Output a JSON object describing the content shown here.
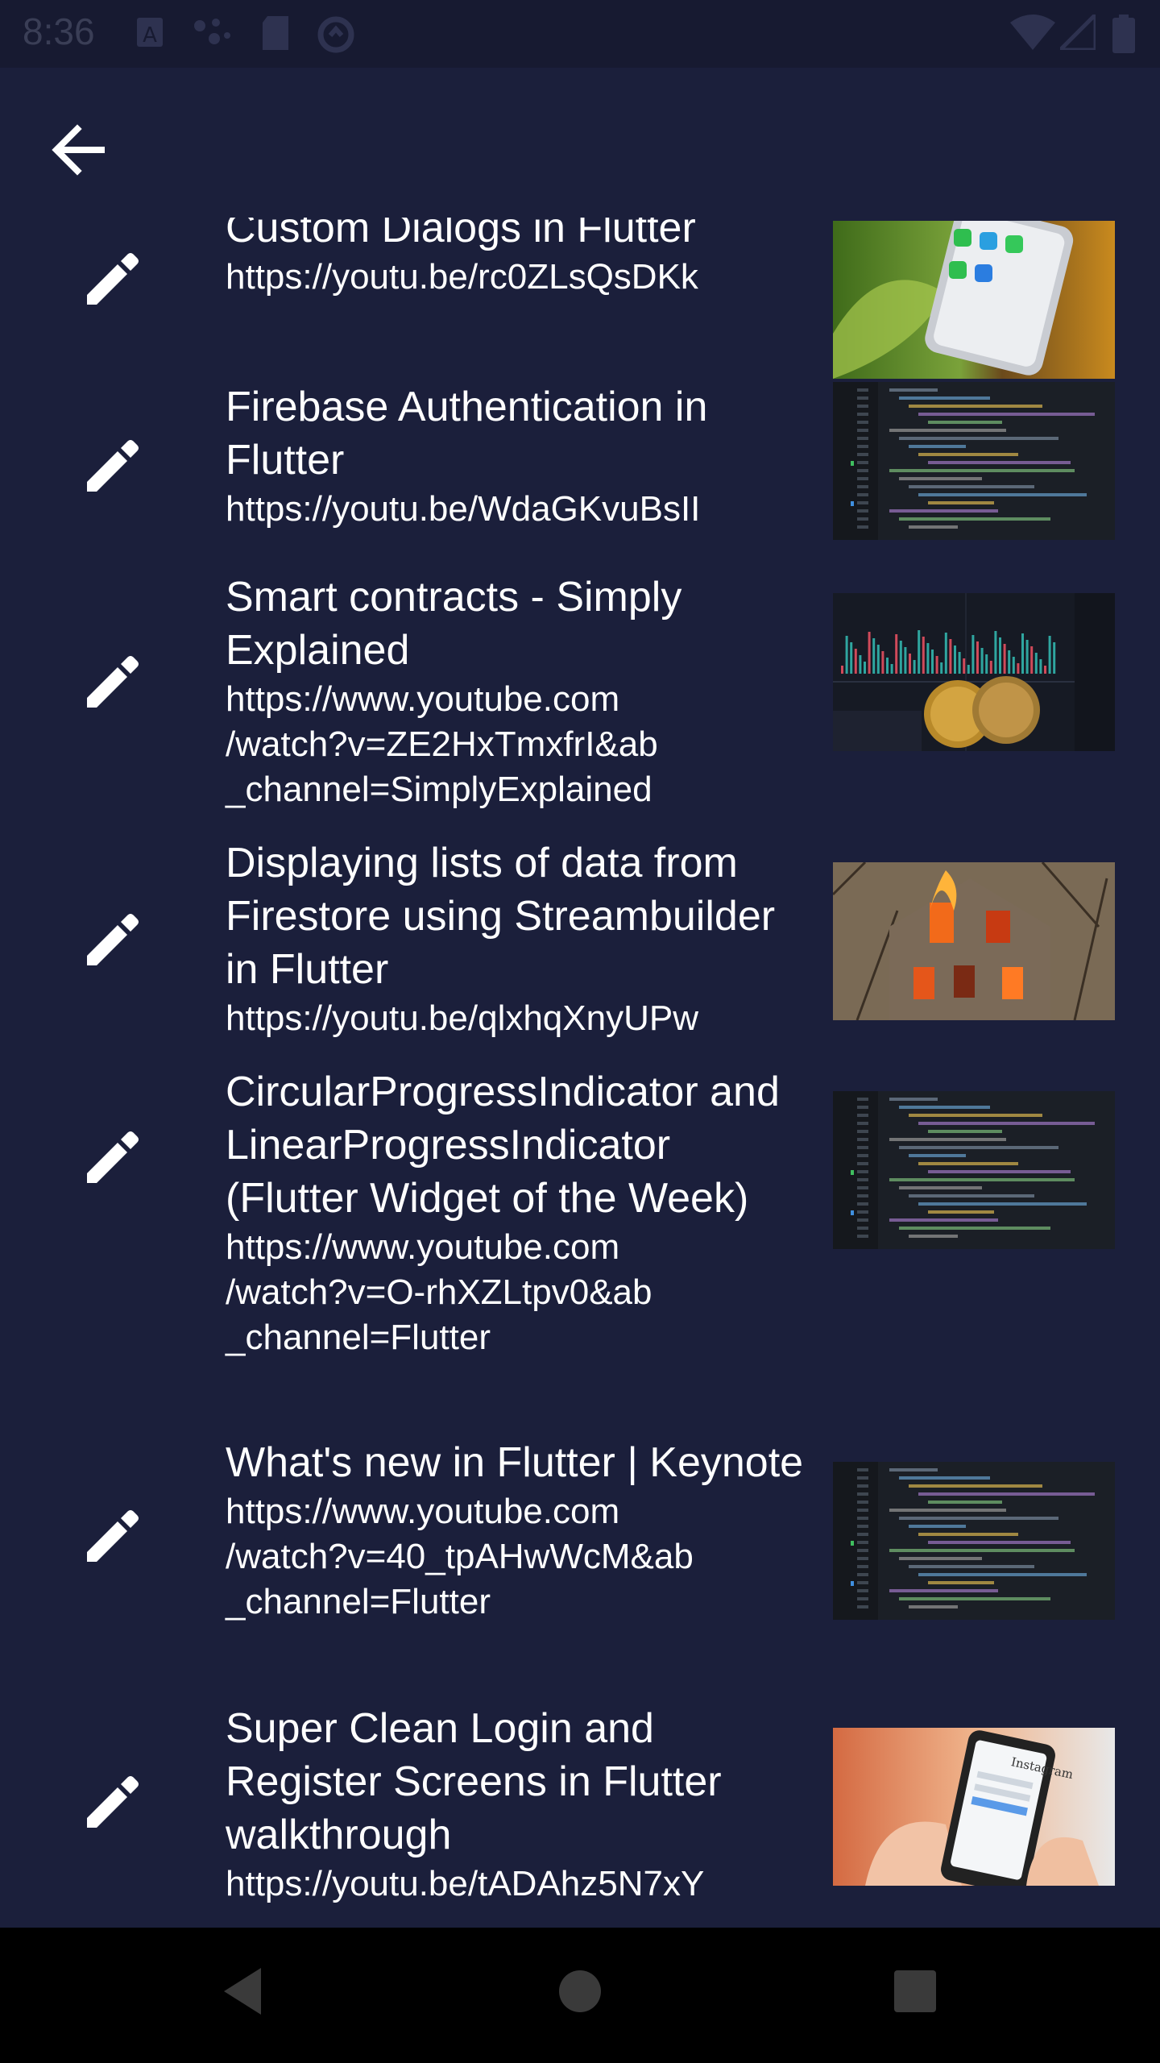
{
  "status_bar": {
    "time": "8:36",
    "icons": [
      "a-icon",
      "dots-icon",
      "sdcard-icon",
      "sync-icon",
      "wifi-icon",
      "signal-icon",
      "battery-icon"
    ]
  },
  "app_bar": {
    "back_icon": "arrow-back-icon"
  },
  "videos": [
    {
      "title": "Custom Dialogs in Flutter",
      "url": "https://youtu.be/rc0ZLsQsDKk",
      "thumbnail": "phone-apps"
    },
    {
      "title": "Firebase Authentication in Flutter",
      "url": "https://youtu.be/WdaGKvuBsII",
      "thumbnail": "code"
    },
    {
      "title": "Smart contracts - Simply Explained",
      "url": "https://www.youtube.com\n/watch?v=ZE2HxTmxfrI&ab\n_channel=SimplyExplained",
      "thumbnail": "crypto"
    },
    {
      "title": "Displaying lists of data from Firestore using Streambuilder in Flutter",
      "url": "https://youtu.be/qlxhqXnyUPw",
      "thumbnail": "fire-house"
    },
    {
      "title": "CircularProgressIndicator and LinearProgressIndicator (Flutter Widget of the Week)",
      "url": "https://www.youtube.com\n/watch?v=O-rhXZLtpv0&ab\n_channel=Flutter",
      "thumbnail": "code"
    },
    {
      "title": "What's new in Flutter | Keynote",
      "url": "https://www.youtube.com\n/watch?v=40_tpAHwWcM&ab\n_channel=Flutter",
      "thumbnail": "code"
    },
    {
      "title": "Super Clean Login and Register Screens in Flutter walkthrough",
      "url": "https://youtu.be/tADAhz5N7xY",
      "thumbnail": "instagram-phone"
    }
  ],
  "nav_bar": {
    "back": "nav-back-icon",
    "home": "nav-home-icon",
    "recents": "nav-recents-icon"
  },
  "colors": {
    "background": "#1b1f3b",
    "status_bar": "#171a31",
    "nav_bar": "#000000",
    "text": "#ffffff"
  }
}
